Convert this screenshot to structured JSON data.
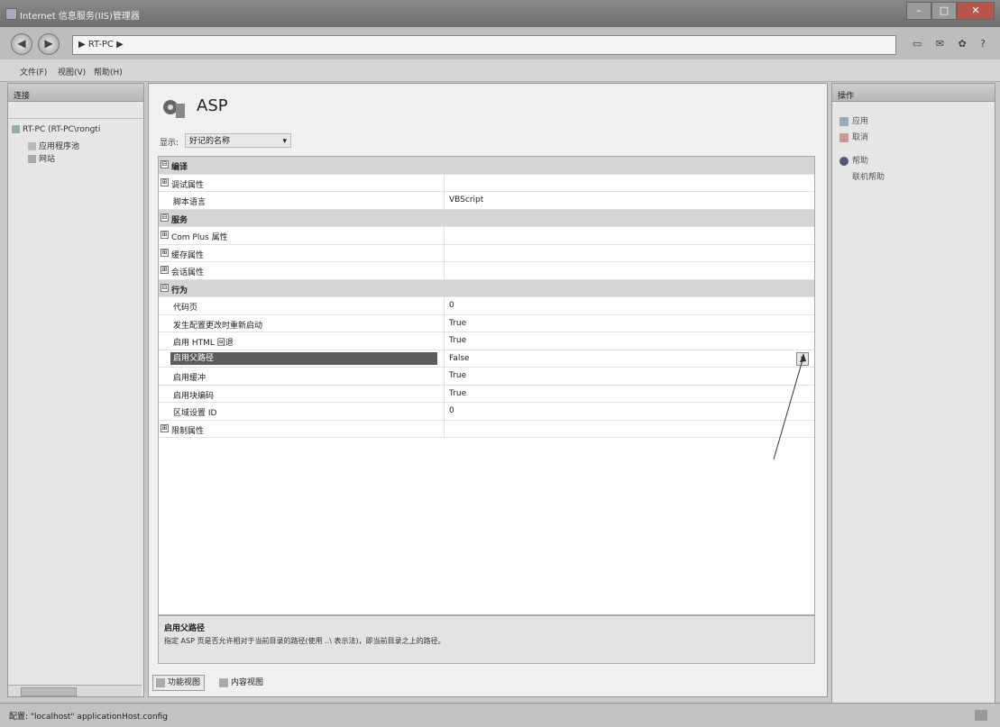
{
  "window": {
    "title": "Internet 信息服务(IIS)管理器",
    "min": "–",
    "max": "□",
    "close": "✕"
  },
  "address": {
    "back": "◀",
    "forward": "▶",
    "crumb": "▶ RT-PC ▶",
    "tools": "▭ ✉ ✿ ?"
  },
  "menu": [
    "文件(F)",
    "视图(V)",
    "帮助(H)"
  ],
  "left_pane": {
    "header": "连接",
    "tree": [
      {
        "label": "RT-PC (RT-PC\\rongti"
      },
      {
        "label": "应用程序池"
      },
      {
        "label": "网站"
      }
    ]
  },
  "center": {
    "title": "ASP",
    "show_label": "显示:",
    "show_value": "好记的名称",
    "rows": [
      {
        "key": "编译",
        "value": "",
        "type": "section",
        "exp": "⊟"
      },
      {
        "key": "调试属性",
        "value": "",
        "type": "group",
        "exp": "⊞"
      },
      {
        "key": "脚本语言",
        "value": "VBScript",
        "type": "prop"
      },
      {
        "key": "服务",
        "value": "",
        "type": "section",
        "exp": "⊟"
      },
      {
        "key": "Com Plus 属性",
        "value": "",
        "type": "group",
        "exp": "⊞"
      },
      {
        "key": "缓存属性",
        "value": "",
        "type": "group",
        "exp": "⊞"
      },
      {
        "key": "会话属性",
        "value": "",
        "type": "group",
        "exp": "⊞"
      },
      {
        "key": "行为",
        "value": "",
        "type": "section",
        "exp": "⊟"
      },
      {
        "key": "代码页",
        "value": "0",
        "type": "prop"
      },
      {
        "key": "发生配置更改时重新启动",
        "value": "True",
        "type": "prop"
      },
      {
        "key": "启用 HTML 回退",
        "value": "True",
        "type": "prop"
      },
      {
        "key": "启用父路径",
        "value": "False",
        "type": "selected"
      },
      {
        "key": "启用缓冲",
        "value": "True",
        "type": "prop"
      },
      {
        "key": "启用块编码",
        "value": "True",
        "type": "prop"
      },
      {
        "key": "区域设置 ID",
        "value": "0",
        "type": "prop"
      },
      {
        "key": "限制属性",
        "value": "",
        "type": "group",
        "exp": "⊞"
      }
    ],
    "description_title": "启用父路径",
    "description_text": "指定 ASP 页是否允许相对于当前目录的路径(使用 ..\\ 表示法)，即当前目录之上的路径。",
    "view_tabs": [
      "功能视图",
      "内容视图"
    ]
  },
  "right_pane": {
    "header": "操作",
    "actions": [
      "应用",
      "取消",
      "帮助",
      "联机帮助"
    ]
  },
  "status": {
    "text": "配置: \"localhost\" applicationHost.config"
  }
}
